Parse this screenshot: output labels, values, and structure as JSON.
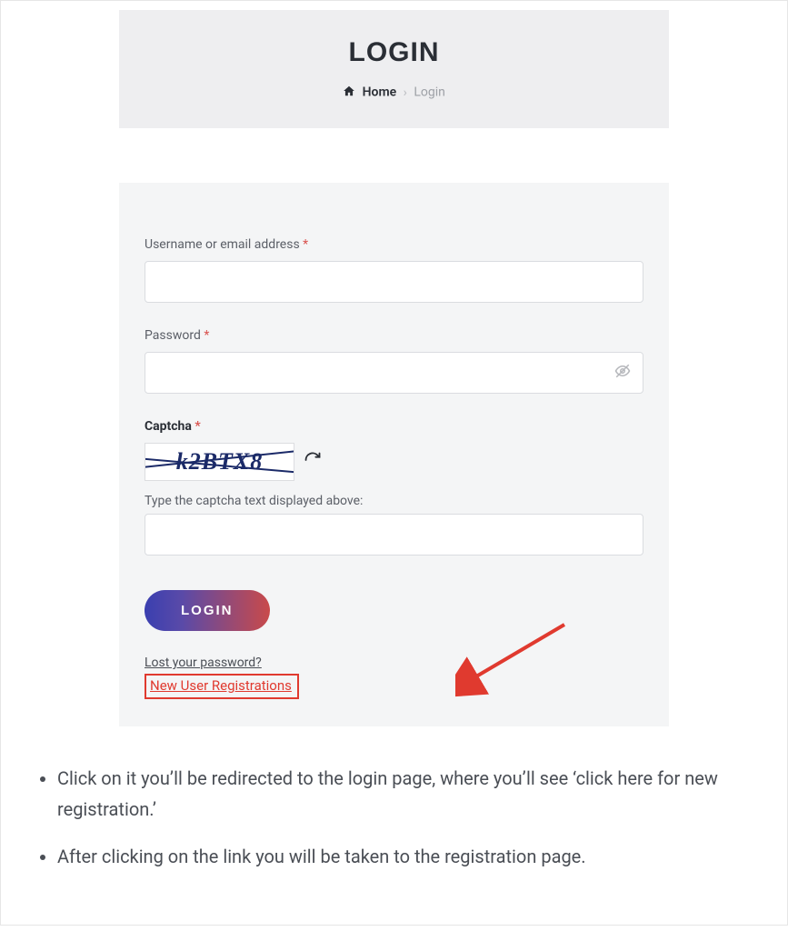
{
  "header": {
    "title": "LOGIN",
    "breadcrumb": {
      "home": "Home",
      "current": "Login"
    }
  },
  "form": {
    "username_label": "Username or email address",
    "password_label": "Password",
    "captcha_label": "Captcha",
    "captcha_text": "k2BTX8",
    "captcha_hint": "Type the captcha text displayed above:",
    "login_button": "LOGIN",
    "lost_password": "Lost your password?",
    "new_user": "New User Registrations",
    "required_mark": "*"
  },
  "instructions": {
    "items": [
      "Click on it you’ll be redirected to the login page, where you’ll see ‘click here for new registration.’",
      "After clicking on the link you will be taken to the registration page."
    ]
  }
}
